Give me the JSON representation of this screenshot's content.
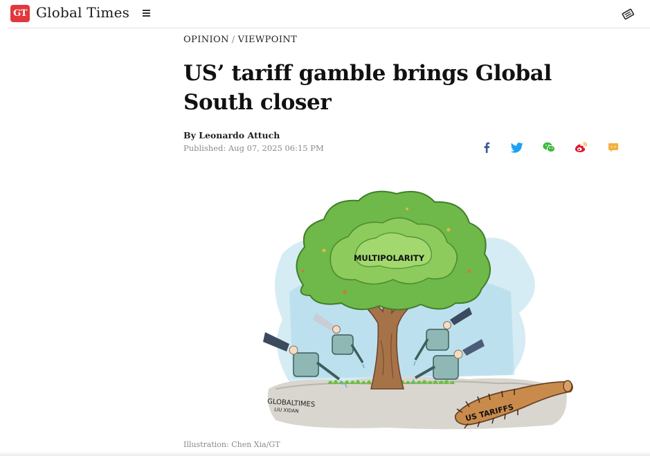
{
  "header": {
    "logo_badge": "GT",
    "logo_text": "Global Times",
    "menu_icon": "hamburger-menu-icon",
    "subscribe_icon": "newspaper-icon"
  },
  "article": {
    "section": "OPINION",
    "subsection": "VIEWPOINT",
    "separator": "/",
    "title": "US’ tariff gamble brings Global South closer",
    "byline": "By Leonardo Attuch",
    "published": "Published: Aug 07, 2025 06:15 PM",
    "caption": "Illustration: Chen Xia/GT"
  },
  "share": [
    {
      "name": "facebook-icon",
      "color": "#3b5998"
    },
    {
      "name": "twitter-icon",
      "color": "#1da1f2"
    },
    {
      "name": "wechat-icon",
      "color": "#3eb93e"
    },
    {
      "name": "weibo-icon",
      "color": "#e6162d"
    },
    {
      "name": "comment-icon",
      "color": "#f5a623"
    }
  ],
  "illustration": {
    "tree_label": "MULTIPOLARITY",
    "club_label": "US TARIFFS",
    "signature_line1": "GLOBALTIMES",
    "signature_line2": "LIU XIDAN"
  },
  "colors": {
    "brand": "#e2383c",
    "foliage": "#6fb84a",
    "trunk": "#a67248",
    "water": "#9fd3e8"
  }
}
